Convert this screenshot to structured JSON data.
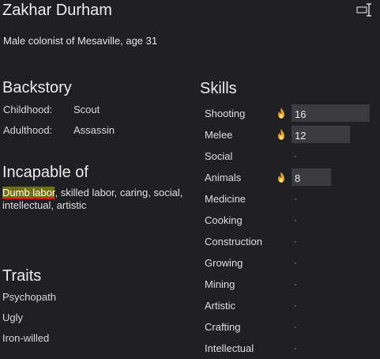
{
  "header": {
    "name": "Zakhar Durham",
    "description": "Male colonist of Mesaville, age 31"
  },
  "backstory": {
    "title": "Backstory",
    "childhood_label": "Childhood:",
    "childhood_value": "Scout",
    "adulthood_label": "Adulthood:",
    "adulthood_value": "Assassin"
  },
  "incapable": {
    "title": "Incapable of",
    "highlighted": "Dumb labor",
    "rest": ", skilled labor, caring, social, intellectual, artistic"
  },
  "traits": {
    "title": "Traits",
    "items": [
      "Psychopath",
      "Ugly",
      "Iron-willed"
    ]
  },
  "skills": {
    "title": "Skills",
    "max_level": 20,
    "items": [
      {
        "name": "Shooting",
        "level": "16",
        "passion": true
      },
      {
        "name": "Melee",
        "level": "12",
        "passion": true
      },
      {
        "name": "Social",
        "level": "-",
        "passion": false
      },
      {
        "name": "Animals",
        "level": "8",
        "passion": true
      },
      {
        "name": "Medicine",
        "level": "-",
        "passion": false
      },
      {
        "name": "Cooking",
        "level": "-",
        "passion": false
      },
      {
        "name": "Construction",
        "level": "-",
        "passion": false
      },
      {
        "name": "Growing",
        "level": "-",
        "passion": false
      },
      {
        "name": "Mining",
        "level": "-",
        "passion": false
      },
      {
        "name": "Artistic",
        "level": "-",
        "passion": false
      },
      {
        "name": "Crafting",
        "level": "-",
        "passion": false
      },
      {
        "name": "Intellectual",
        "level": "-",
        "passion": false
      }
    ]
  },
  "icons": {
    "rename": "rename-icon",
    "passion": "flame-icon"
  },
  "colors": {
    "background": "#1e2024",
    "skill_bar": "#3a3c40",
    "passion": "#f0a020",
    "highlight": "#707010"
  }
}
